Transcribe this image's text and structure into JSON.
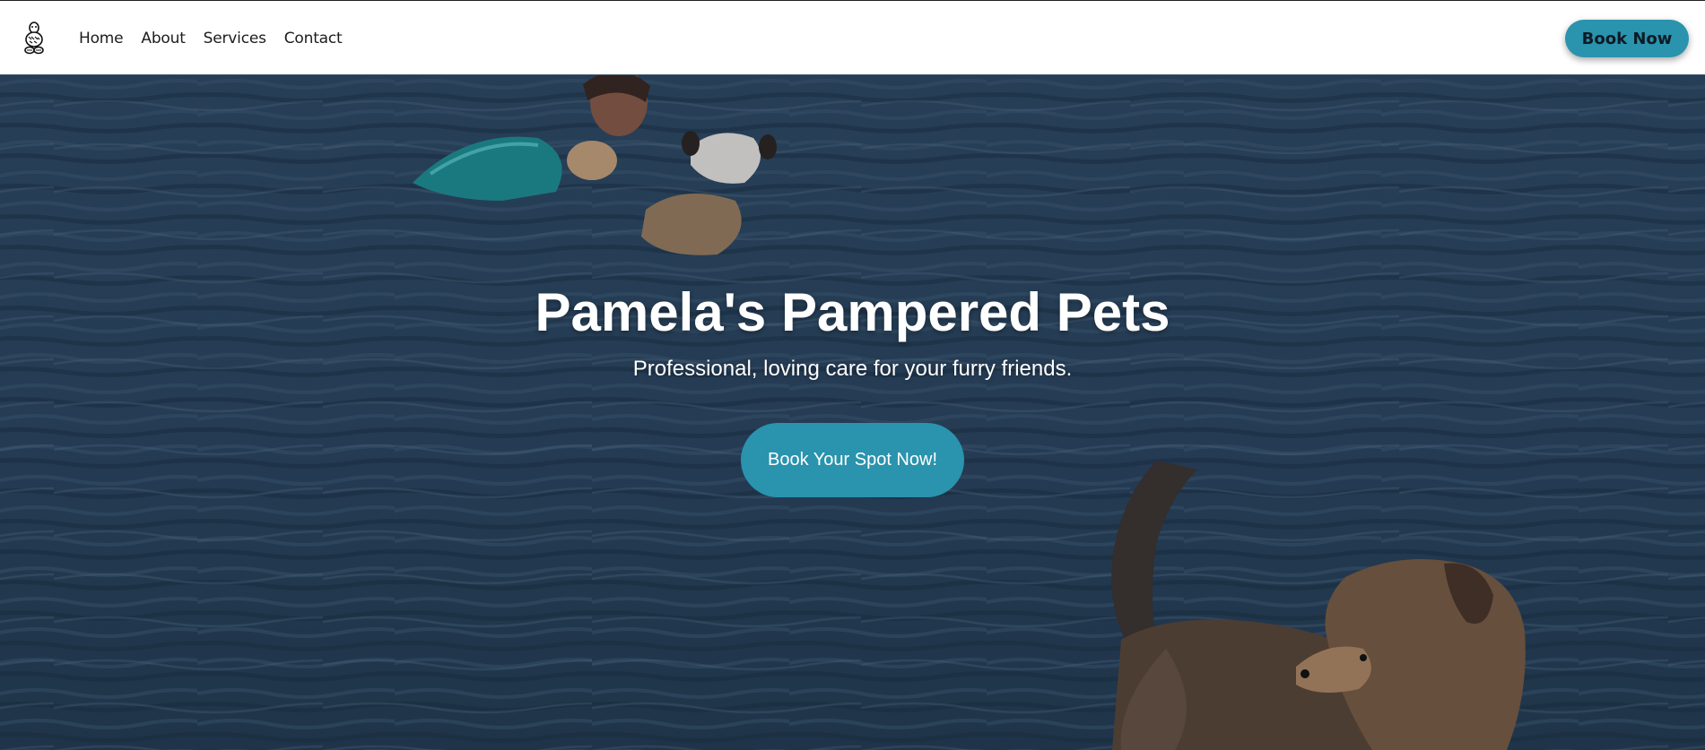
{
  "nav": {
    "logo_icon": "paw-logo-icon",
    "links": [
      {
        "label": "Home"
      },
      {
        "label": "About"
      },
      {
        "label": "Services"
      },
      {
        "label": "Contact"
      }
    ],
    "book_now_label": "Book Now"
  },
  "hero": {
    "title": "Pamela's Pampered Pets",
    "subtitle": "Professional, loving care for your furry friends.",
    "cta_label": "Book Your Spot Now!",
    "background_image": "dogs-swimming-in-lake"
  },
  "colors": {
    "accent": "#2a93ad",
    "nav_background": "#ffffff",
    "water": "#2b4560"
  }
}
